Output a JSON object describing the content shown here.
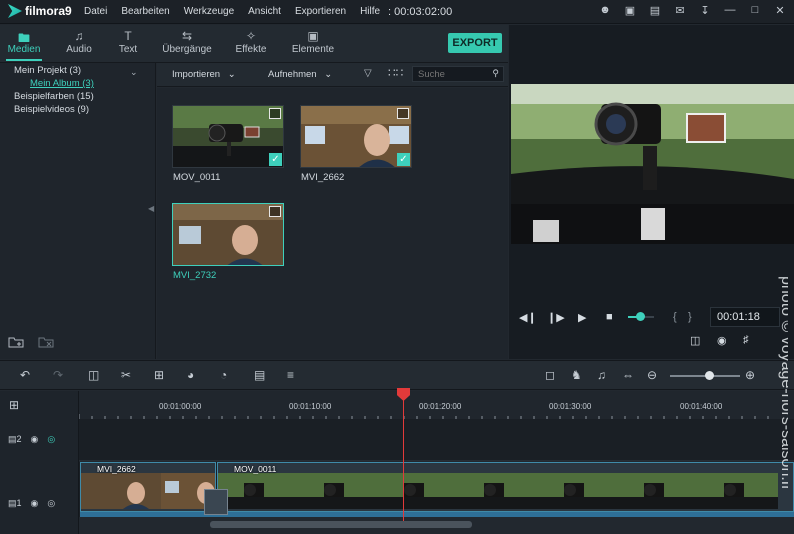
{
  "app": {
    "name": "filmora9",
    "timecode": "00:03:02:00"
  },
  "menu": [
    "Datei",
    "Bearbeiten",
    "Werkzeuge",
    "Ansicht",
    "Exportieren",
    "Hilfe"
  ],
  "tabs": [
    {
      "label": "Medien",
      "icon": "folder-icon",
      "active": true
    },
    {
      "label": "Audio",
      "icon": "music-note-icon"
    },
    {
      "label": "Text",
      "icon": "text-icon"
    },
    {
      "label": "Übergänge",
      "icon": "transition-icon"
    },
    {
      "label": "Effekte",
      "icon": "effects-icon"
    },
    {
      "label": "Elemente",
      "icon": "image-icon"
    }
  ],
  "export_label": "EXPORT",
  "project_tree": {
    "project": "Mein Projekt (3)",
    "album": "Mein Album (3)",
    "colors": "Beispielfarben (15)",
    "videos": "Beispielvideos (9)"
  },
  "media_toolbar": {
    "import": "Importieren",
    "record": "Aufnehmen",
    "search_placeholder": "Suche"
  },
  "media": [
    {
      "name": "MOV_0011",
      "checked": true
    },
    {
      "name": "MVI_2662",
      "checked": true
    },
    {
      "name": "MVI_2732",
      "selected": true
    }
  ],
  "preview": {
    "timecode": "00:01:18"
  },
  "ruler": [
    "00:01:00:00",
    "00:01:10:00",
    "00:01:20:00",
    "00:01:30:00",
    "00:01:40:00"
  ],
  "tracks": [
    {
      "number": "2"
    },
    {
      "number": "1"
    }
  ],
  "clips": [
    {
      "name": "MVI_2662"
    },
    {
      "name": "MOV_0011"
    }
  ],
  "watermark": "photo © voyage-hors-saison.fr",
  "colors": {
    "accent": "#3ed0bc",
    "playhead": "#e23a3a",
    "export": "#36c9b0"
  }
}
